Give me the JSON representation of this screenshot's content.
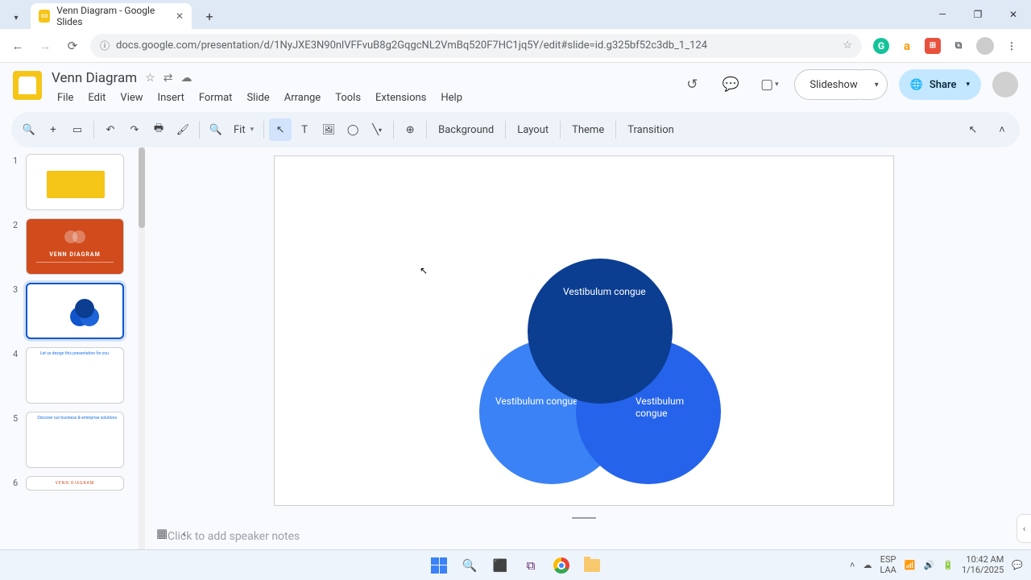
{
  "browser": {
    "tab_title": "Venn Diagram - Google Slides",
    "url": "docs.google.com/presentation/d/1NyJXE3N90nlVFFvuB8g2GqgcNL2VmBq520F7HC1jq5Y/edit#slide=id.g325bf52c3db_1_124"
  },
  "doc": {
    "title": "Venn Diagram",
    "menus": [
      "File",
      "Edit",
      "View",
      "Insert",
      "Format",
      "Slide",
      "Arrange",
      "Tools",
      "Extensions",
      "Help"
    ]
  },
  "header": {
    "slideshow": "Slideshow",
    "share": "Share"
  },
  "toolbar": {
    "zoom": "Fit",
    "background": "Background",
    "layout": "Layout",
    "theme": "Theme",
    "transition": "Transition"
  },
  "filmstrip": {
    "slides": [
      {
        "num": "1"
      },
      {
        "num": "2",
        "label": "VENN DIAGRAM"
      },
      {
        "num": "3"
      },
      {
        "num": "4",
        "title": "Let us design this presentation for you."
      },
      {
        "num": "5",
        "title": "Discover our business & enterprise solutions"
      },
      {
        "num": "6",
        "label": "VENN DIAGRAM"
      }
    ]
  },
  "canvas": {
    "top": "Vestibulum congue",
    "left": "Vestibulum congue",
    "right": "Vestibulum congue"
  },
  "notes_placeholder": "Click to add speaker notes",
  "tray": {
    "lang1": "ESP",
    "lang2": "LAA",
    "time": "10:42 AM",
    "date": "1/16/2025"
  }
}
